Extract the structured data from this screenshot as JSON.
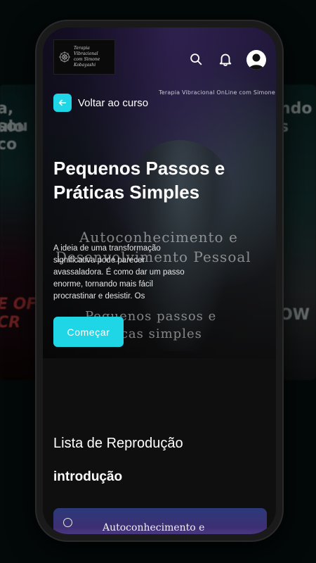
{
  "app": {
    "logo_line1": "Terapia Vibracional",
    "logo_line2": "com Simone Kobayashi"
  },
  "course": {
    "subtitle": "Terapia Vibracional OnLine com Simone Kobayashi",
    "back_label": "Voltar ao curso",
    "title": "Pequenos Passos e Práticas Simples",
    "description": "A ideia de uma transformação significativa pode parecer avassaladora. É como dar um passo enorme, tornando mais fácil procrastinar e desistir. Os",
    "cta_label": "Começar",
    "hero_overlay": {
      "line1": "Autoconhecimento e",
      "line2": "Desenvolvimento Pessoal",
      "line3": "Pequenos passos e",
      "line4": "práticas simples"
    }
  },
  "playlist": {
    "heading": "Lista de Reprodução",
    "module_title": "introdução",
    "first_item_text": "Autoconhecimento e"
  },
  "background": {
    "left_text_1": "a, sou",
    "left_text_2": "ulo co",
    "right_text_1": "ndo",
    "right_text_2": "s",
    "left_text_3": "E OF",
    "left_text_4": "CR",
    "right_text_3": "OW"
  },
  "colors": {
    "accent": "#1fd6e6",
    "background": "#07100f",
    "screen": "#0f0f10"
  },
  "icons": {
    "header": [
      "search-icon",
      "bell-icon",
      "user-avatar-icon"
    ],
    "back": "arrow-left-icon"
  }
}
